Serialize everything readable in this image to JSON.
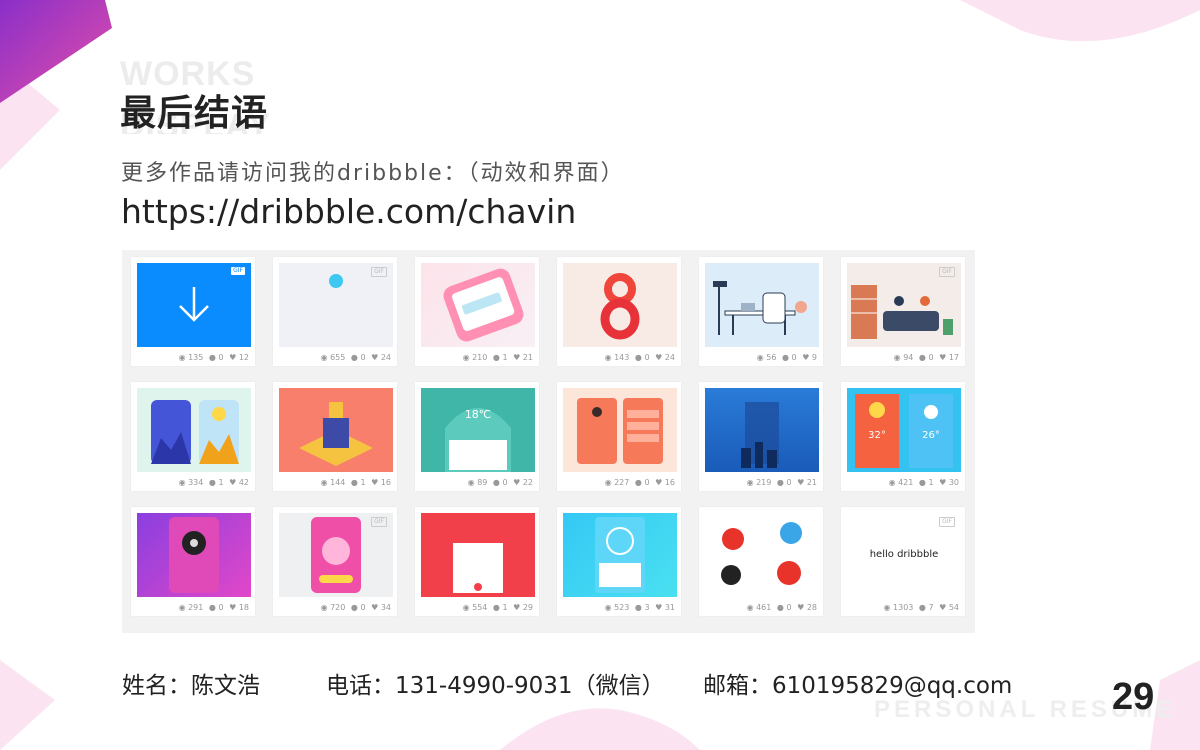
{
  "header": {
    "ghost_top": "WORKS",
    "ghost_bottom": "DISPLAY",
    "title": "最后结语",
    "subtitle": "更多作品请访问我的dribbble：（动效和界面）",
    "link": "https://dribbble.com/chavin"
  },
  "gallery": {
    "gif_label": "GIF",
    "text_tile": "hello dribbble",
    "cards": [
      {
        "views": "135",
        "comments": "0",
        "likes": "12",
        "gif": true
      },
      {
        "views": "655",
        "comments": "0",
        "likes": "24",
        "gif": true
      },
      {
        "views": "210",
        "comments": "1",
        "likes": "21",
        "gif": false
      },
      {
        "views": "143",
        "comments": "0",
        "likes": "24",
        "gif": false
      },
      {
        "views": "56",
        "comments": "0",
        "likes": "9",
        "gif": false
      },
      {
        "views": "94",
        "comments": "0",
        "likes": "17",
        "gif": true
      },
      {
        "views": "334",
        "comments": "1",
        "likes": "42",
        "gif": false
      },
      {
        "views": "144",
        "comments": "1",
        "likes": "16",
        "gif": false
      },
      {
        "views": "89",
        "comments": "0",
        "likes": "22",
        "gif": false
      },
      {
        "views": "227",
        "comments": "0",
        "likes": "16",
        "gif": false
      },
      {
        "views": "219",
        "comments": "0",
        "likes": "21",
        "gif": false
      },
      {
        "views": "421",
        "comments": "1",
        "likes": "30",
        "gif": false
      },
      {
        "views": "291",
        "comments": "0",
        "likes": "18",
        "gif": false
      },
      {
        "views": "720",
        "comments": "0",
        "likes": "34",
        "gif": true
      },
      {
        "views": "554",
        "comments": "1",
        "likes": "29",
        "gif": false
      },
      {
        "views": "523",
        "comments": "3",
        "likes": "31",
        "gif": false
      },
      {
        "views": "461",
        "comments": "0",
        "likes": "28",
        "gif": false
      },
      {
        "views": "1303",
        "comments": "7",
        "likes": "54",
        "gif": true
      }
    ]
  },
  "footer": {
    "name": "姓名：陈文浩",
    "phone": "电话：131-4990-9031（微信）",
    "email": "邮箱：610195829@qq.com",
    "page_number": "29",
    "ghost": "PERSONAL RESUME"
  },
  "colors": {
    "accent_pink": "#f4b6d8",
    "accent_purple": "#9b3fc6",
    "panel_bg": "#f2f2f2"
  }
}
